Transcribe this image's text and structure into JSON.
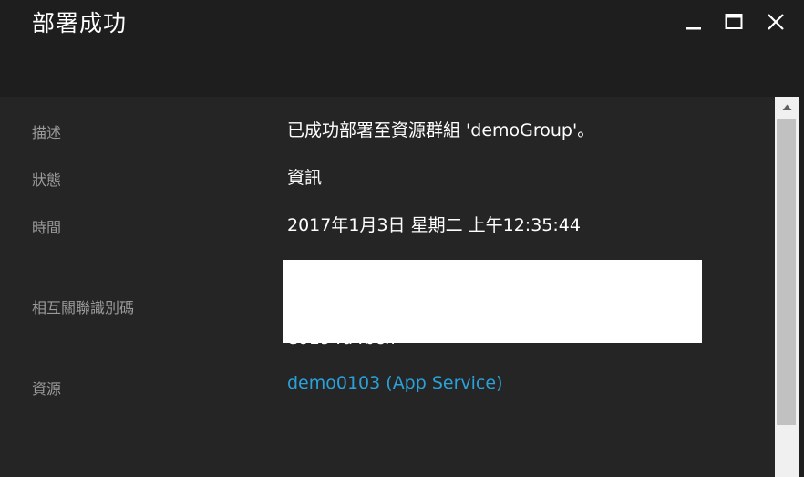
{
  "window": {
    "title": "部署成功"
  },
  "details": {
    "description_label": "描述",
    "description_value": "已成功部署至資源群組 'demoGroup'。",
    "status_label": "狀態",
    "status_value": "資訊",
    "time_label": "時間",
    "time_value": "2017年1月3日 星期二 上午12:35:44",
    "correlation_label": "相互關聯識別碼",
    "correlation_value_visible": "e0194d4bcff",
    "resource_label": "資源",
    "resource_value": "demo0103 (App Service)"
  },
  "colors": {
    "header_bg": "#1e1e1e",
    "content_bg": "#252526",
    "label": "#9a9a9a",
    "value": "#ffffff",
    "link": "#2aa1d9",
    "redaction": "#ffffff"
  },
  "icons": {
    "minimize": "minimize-icon",
    "maximize": "maximize-icon",
    "close": "close-icon",
    "scroll_up": "scroll-up-arrow-icon"
  }
}
